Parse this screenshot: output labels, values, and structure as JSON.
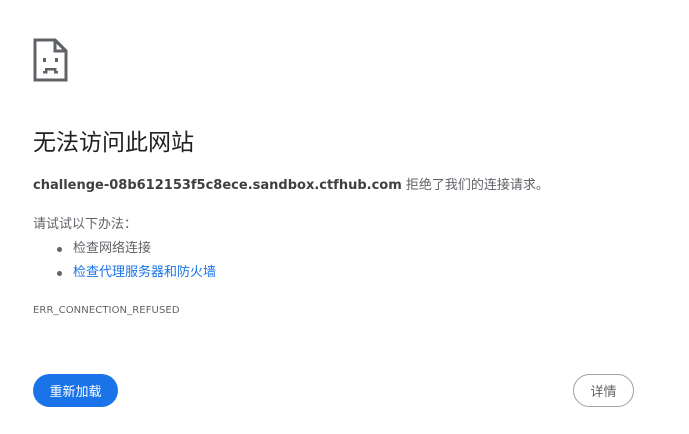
{
  "page": {
    "title": "无法访问此网站",
    "icon": "sad-page-icon"
  },
  "summary": {
    "host": "challenge-08b612153f5c8ece.sandbox.ctfhub.com",
    "message": " 拒绝了我们的连接请求。"
  },
  "suggestions": {
    "heading": "请试试以下办法：",
    "items": [
      {
        "label": "检查网络连接",
        "is_link": false
      },
      {
        "label": "检查代理服务器和防火墙",
        "is_link": true
      }
    ]
  },
  "error_code": "ERR_CONNECTION_REFUSED",
  "buttons": {
    "reload_label": "重新加载",
    "details_label": "详情"
  },
  "colors": {
    "accent": "#1a73e8",
    "text_primary": "#202124",
    "text_secondary": "#5f6368",
    "border": "#9aa0a6"
  }
}
